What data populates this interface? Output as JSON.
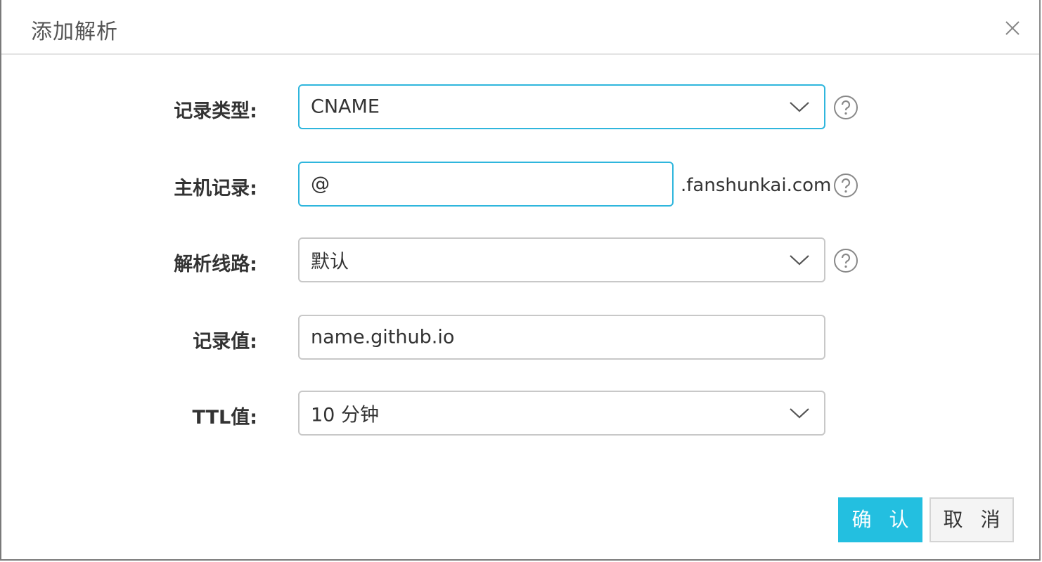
{
  "dialog": {
    "title": "添加解析",
    "close_icon": "close-icon"
  },
  "form": {
    "record_type": {
      "label": "记录类型:",
      "value": "CNAME",
      "focused": true
    },
    "host_record": {
      "label": "主机记录:",
      "value": "@",
      "suffix": ".fanshunkai.com",
      "focused": true
    },
    "line": {
      "label": "解析线路:",
      "value": "默认"
    },
    "record_value": {
      "label": "记录值:",
      "value": "name.github.io"
    },
    "ttl": {
      "label": "TTL值:",
      "value": "10 分钟"
    }
  },
  "buttons": {
    "confirm": "确 认",
    "cancel": "取 消"
  },
  "colors": {
    "accent": "#23bfe0",
    "focus_border": "#2fb6dd",
    "border": "#c8c8c8"
  }
}
